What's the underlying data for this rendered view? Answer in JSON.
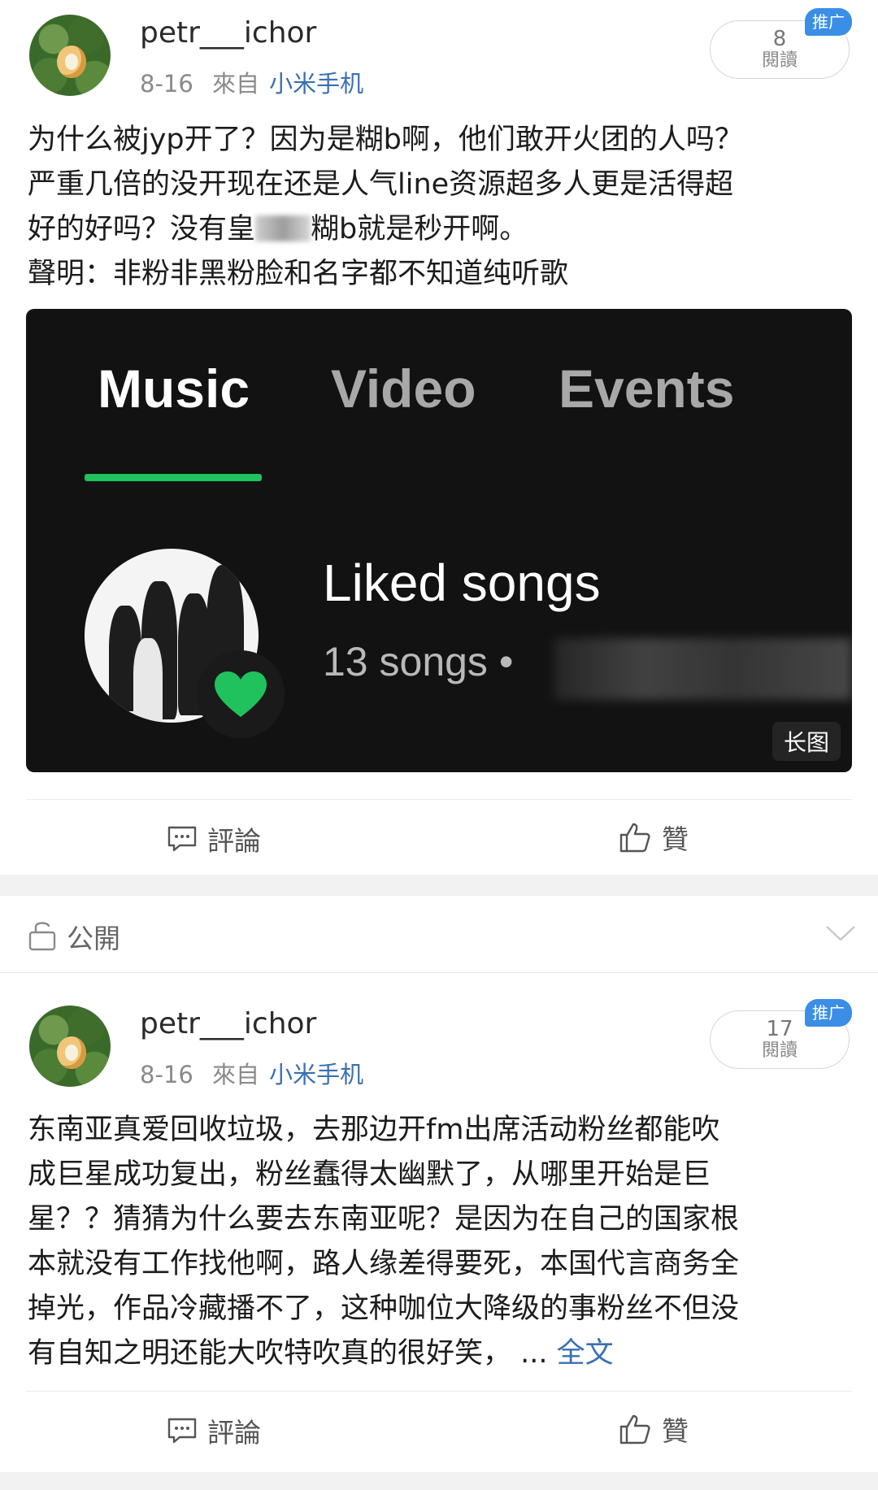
{
  "post1": {
    "username": "petr___ichor",
    "date": "8-16",
    "source_prefix": "來自",
    "source": "小米手机",
    "reads_count": "8",
    "reads_label": "閱讀",
    "ad_badge": "推广",
    "text_lines": [
      "为什么被jyp开了？因为是糊b啊，他们敢开火团的人吗？",
      "严重几倍的没开现在还是人气line资源超多人更是活得超",
      "好的好吗？没有皇",
      "糊b就是秒开啊。",
      "聲明：非粉非黑粉脸和名字都不知道纯听歌"
    ],
    "image": {
      "tabs": [
        "Music",
        "Video",
        "Events"
      ],
      "active_tab": "Music",
      "accent": "#1fc25d",
      "title": "Liked songs",
      "subtitle": "13 songs •",
      "badge": "长图",
      "heart_icon": "heart-icon"
    },
    "comment_label": "評論",
    "like_label": "贊"
  },
  "privacy": {
    "label": "公開",
    "icon": "lock-open-icon"
  },
  "post2": {
    "username": "petr___ichor",
    "date": "8-16",
    "source_prefix": "來自",
    "source": "小米手机",
    "reads_count": "17",
    "reads_label": "閱讀",
    "ad_badge": "推广",
    "text_lines": [
      "东南亚真爱回收垃圾，去那边开fm出席活动粉丝都能吹",
      "成巨星成功复出，粉丝蠢得太幽默了，从哪里开始是巨",
      "星？？猜猜为什么要去东南亚呢？是因为在自己的国家根",
      "本就没有工作找他啊，路人缘差得要死，本国代言商务全",
      "掉光，作品冷藏播不了，这种咖位大降级的事粉丝不但没",
      "有自知之明还能大吹特吹真的很好笑，"
    ],
    "ellipsis": " ... ",
    "full_text_link": "全文",
    "comment_label": "評論",
    "like_label": "贊"
  },
  "colors": {
    "link": "#3a6fb0",
    "badge_blue": "#3b8ee6",
    "spotify_green": "#1fc25d"
  }
}
